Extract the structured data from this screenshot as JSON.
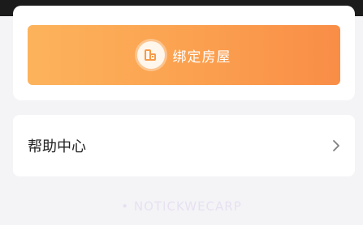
{
  "bind_house": {
    "label": "绑定房屋",
    "icon": "house-icon",
    "gradient_colors": [
      "#fcb35b",
      "#f98d47"
    ]
  },
  "help_center": {
    "label": "帮助中心",
    "icon": "chevron-right-icon"
  },
  "footer": {
    "watermark": "• NOTICKWECARP"
  }
}
